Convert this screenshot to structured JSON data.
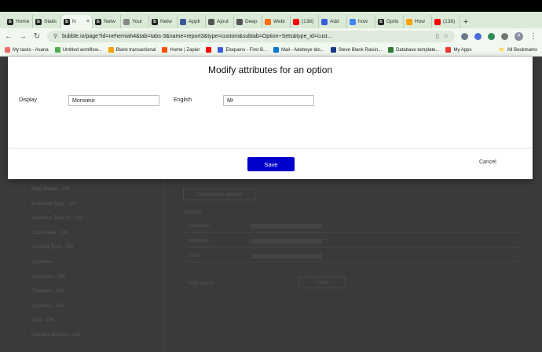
{
  "browser": {
    "tabs": [
      {
        "label": "Home",
        "fav": "b",
        "color": "#222222"
      },
      {
        "label": "Static",
        "fav": "b",
        "color": "#222222"
      },
      {
        "label": "N",
        "fav": "b",
        "color": "#222222",
        "active": true
      },
      {
        "label": "Netw",
        "fav": "b",
        "color": "#222222"
      },
      {
        "label": "Your",
        "fav": "",
        "color": "#888888"
      },
      {
        "label": "Netw",
        "fav": "b",
        "color": "#222222"
      },
      {
        "label": "Appli",
        "fav": "",
        "color": "#3b5998"
      },
      {
        "label": "Ajout",
        "fav": "",
        "color": "#555555"
      },
      {
        "label": "Deep",
        "fav": "",
        "color": "#555555"
      },
      {
        "label": "Webi",
        "fav": "",
        "color": "#ff6d00"
      },
      {
        "label": "(138)",
        "fav": "",
        "color": "#ff0000"
      },
      {
        "label": "Add",
        "fav": "",
        "color": "#3b5bdb"
      },
      {
        "label": "how",
        "fav": "",
        "color": "#4285f4"
      },
      {
        "label": "Optio",
        "fav": "b",
        "color": "#222222"
      },
      {
        "label": "How",
        "fav": "",
        "color": "#f4a300"
      },
      {
        "label": "(138)",
        "fav": "",
        "color": "#ff0000"
      }
    ],
    "url": "bubble.io/page?id=nehemiah4&tab=tabs-3&name=report3&type=custom&subtab=Option+Sets&type_id=cust...",
    "avatar_initial": "A",
    "bookmarks": [
      {
        "label": "My tasks - Asana",
        "color": "#f06a6a"
      },
      {
        "label": "Untitled workflow...",
        "color": "#4caf50"
      },
      {
        "label": "Blank transactional",
        "color": "#f4a300"
      },
      {
        "label": "Home | Zapier",
        "color": "#ff4f00"
      },
      {
        "label": "",
        "color": "#ff0000"
      },
      {
        "label": "Eloquens - First B...",
        "color": "#3b5bdb"
      },
      {
        "label": "Mail - Adeboye Ido...",
        "color": "#0078d4"
      },
      {
        "label": "Steve Blank Raisin...",
        "color": "#1a3a8a"
      },
      {
        "label": "Database template...",
        "color": "#2e7d32"
      },
      {
        "label": "My Apps",
        "color": "#e53935"
      }
    ],
    "all_bookmarks": "All Bookmarks"
  },
  "background": {
    "option_sets": [
      "Blog Status - OS",
      "Business Type - OS",
      "Business Type Fr - OS",
      "Chart Filter - OS",
      "Contact Type - OS",
      "Countries",
      "Countries - OS",
      "Counters - OS",
      "Currency - OS",
      "Date - OS",
      "Delivery Method - OS"
    ],
    "create_attr_label": "Create a new attribute",
    "options_label": "Options",
    "options": [
      {
        "name": "Monsieur",
        "meta": "..."
      },
      {
        "name": "Madame",
        "meta": "..."
      },
      {
        "name": "Miss",
        "meta": "..."
      }
    ],
    "new_option_label": "New option",
    "create_btn": "Create"
  },
  "modal": {
    "title": "Modify attributes for an option",
    "display_label": "Display",
    "display_value": "Monsieur",
    "english_label": "English",
    "english_value": "Mr",
    "save_label": "Save",
    "cancel_label": "Cancel"
  }
}
